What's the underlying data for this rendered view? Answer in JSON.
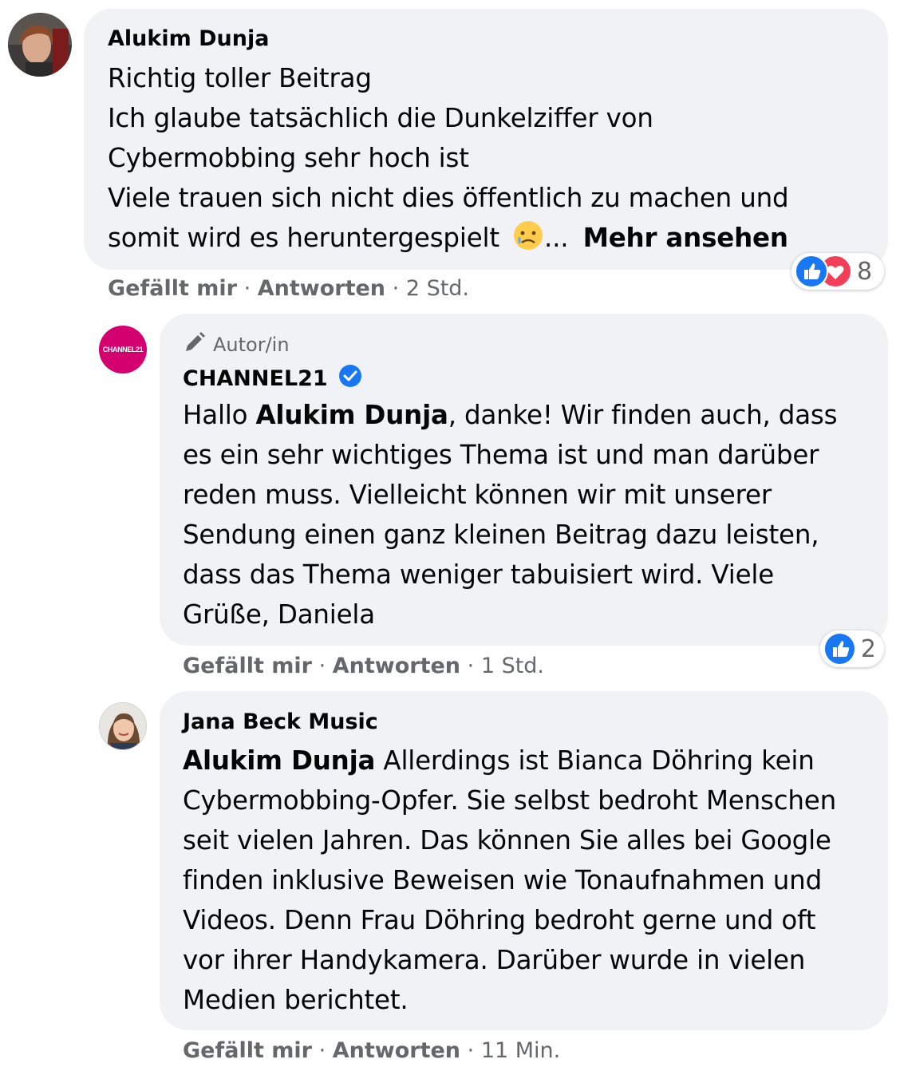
{
  "comments": [
    {
      "author": "Alukim Dunja",
      "lines": [
        "Richtig toller Beitrag",
        "Ich glaube tatsächlich die Dunkelziffer von",
        "Cybermobbing sehr hoch ist",
        "Viele trauen sich nicht dies öffentlich zu machen und",
        "somit wird es heruntergespielt"
      ],
      "emoji": "😥",
      "ellipsis": "...",
      "see_more": "Mehr ansehen",
      "reaction_count": "8",
      "like_label": "Gefällt mir",
      "reply_label": "Antworten",
      "time": "2 Std.",
      "sep": "·"
    },
    {
      "author_badge": "Autor/in",
      "author": "CHANNEL21",
      "avatar_text": "CHANNEL21",
      "mention": "Alukim Dunja",
      "line1_prefix": "Hallo",
      "line1_suffix": ", danke! Wir finden auch, dass",
      "lines": [
        "es ein sehr wichtiges Thema ist und man darüber",
        "reden muss. Vielleicht können wir mit unserer",
        "Sendung einen ganz kleinen Beitrag dazu leisten,",
        "dass das Thema weniger tabuisiert wird. Viele",
        "Grüße, Daniela"
      ],
      "reaction_count": "2",
      "like_label": "Gefällt mir",
      "reply_label": "Antworten",
      "time": "1 Std.",
      "sep": "·"
    },
    {
      "author": "Jana Beck Music",
      "mention": "Alukim Dunja",
      "line1_suffix": " Allerdings ist Bianca Döhring kein",
      "lines": [
        "Cybermobbing-Opfer. Sie selbst bedroht Menschen",
        "seit vielen Jahren. Das können Sie alles bei Google",
        "finden inklusive Beweisen wie Tonaufnahmen und",
        "Videos. Denn Frau Döhring bedroht gerne und oft",
        "vor ihrer Handykamera. Darüber wurde in vielen",
        "Medien berichtet."
      ],
      "like_label": "Gefällt mir",
      "reply_label": "Antworten",
      "time": "11 Min.",
      "sep": "·"
    }
  ],
  "colors": {
    "bubble": "#f0f2f5",
    "meta": "#65676b",
    "like_blue": "#1877f2",
    "love_red": "#f33e58",
    "channel_pink": "#d4006f"
  }
}
